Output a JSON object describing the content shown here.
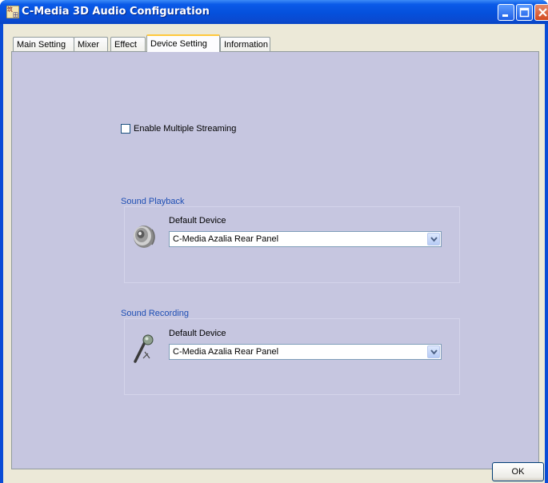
{
  "window": {
    "title": "C-Media 3D Audio Configuration"
  },
  "tabs": [
    {
      "label": "Main Setting"
    },
    {
      "label": "Mixer"
    },
    {
      "label": "Effect"
    },
    {
      "label": "Device Setting",
      "active": true
    },
    {
      "label": "Information"
    }
  ],
  "device_setting": {
    "enable_multiple_streaming": {
      "label": "Enable Multiple Streaming",
      "checked": false
    },
    "sound_playback": {
      "title": "Sound Playback",
      "device_label": "Default Device",
      "selected_device": "C-Media Azalia Rear Panel",
      "icon": "speaker-icon"
    },
    "sound_recording": {
      "title": "Sound Recording",
      "device_label": "Default Device",
      "selected_device": "C-Media Azalia Rear Panel",
      "icon": "microphone-icon"
    }
  },
  "footer": {
    "ok_label": "OK"
  },
  "colors": {
    "panel_background": "#c6c6e0",
    "group_title": "#1f4fb4",
    "titlebar": "#0550dc"
  }
}
